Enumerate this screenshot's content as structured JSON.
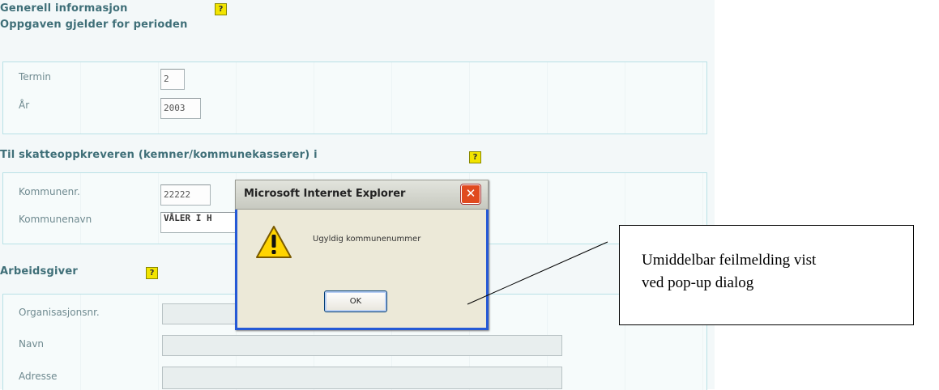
{
  "form": {
    "general_heading": "Generell informasjon",
    "period_heading": "Oppgaven gjelder for perioden",
    "termin_label": "Termin",
    "termin_value": "2",
    "year_label": "År",
    "year_value": "2003",
    "tax_heading": "Til skatteoppkreveren (kemner/kommunekasserer) i",
    "kommunenr_label": "Kommunenr.",
    "kommunenr_value": "22222",
    "kommunenavn_label": "Kommunenavn",
    "kommunenavn_value": "VÅLER I H",
    "employer_heading": "Arbeidsgiver",
    "orgnr_label": "Organisasjonsnr.",
    "name_label": "Navn",
    "address_label": "Adresse",
    "help_glyph": "?"
  },
  "dialog": {
    "title": "Microsoft Internet Explorer",
    "close_glyph": "✕",
    "message": "Ugyldig kommunenummer",
    "ok_label": "OK",
    "icon": "warning-icon"
  },
  "callout": {
    "text": "Umiddelbar feilmelding vist\nved pop-up dialog"
  },
  "colors": {
    "heading": "#3f6f78",
    "box_border": "#b9e1e6",
    "titlebar_close": "#e04a1f",
    "help_icon": "#f2e400"
  }
}
